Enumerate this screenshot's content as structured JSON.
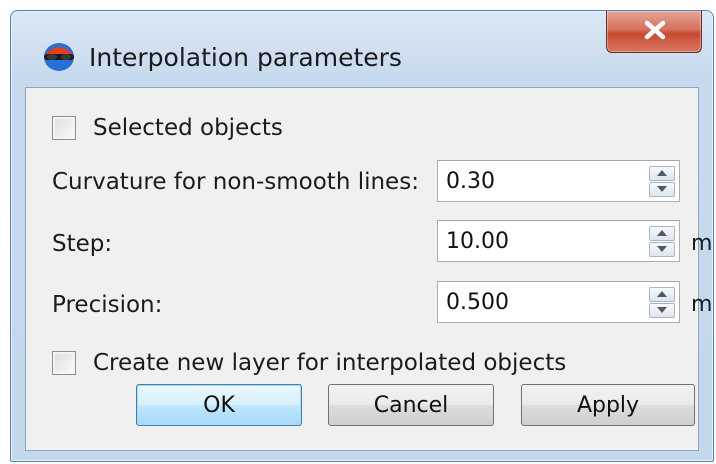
{
  "window": {
    "title": "Interpolation parameters",
    "icon": "app-globe-icon",
    "close_icon": "close-icon"
  },
  "options": {
    "selected_objects": {
      "label": "Selected objects",
      "checked": false
    },
    "create_new_layer": {
      "label": "Create new layer for interpolated objects",
      "checked": false
    }
  },
  "fields": {
    "curvature": {
      "label": "Curvature for non-smooth lines:",
      "value": "0.30",
      "unit": ""
    },
    "step": {
      "label": "Step:",
      "value": "10.00",
      "unit": "m"
    },
    "precision": {
      "label": "Precision:",
      "value": "0.500",
      "unit": "m"
    }
  },
  "buttons": {
    "ok": "OK",
    "cancel": "Cancel",
    "apply": "Apply"
  },
  "colors": {
    "close_button": "#c74a33",
    "title_gradient": "#c6d9ee",
    "default_button": "#bee6fd"
  }
}
